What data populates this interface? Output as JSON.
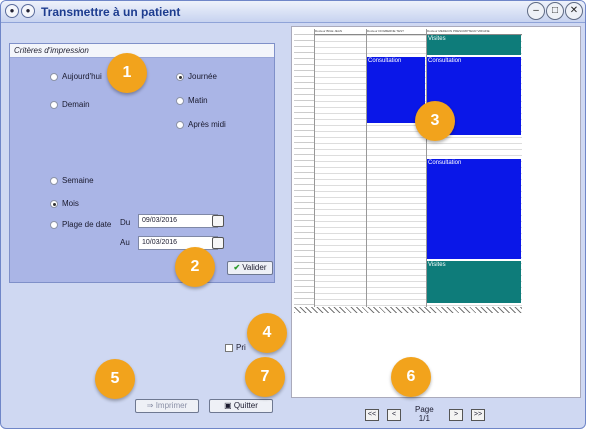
{
  "window": {
    "title": "Transmettre à un patient",
    "controls": [
      "minimize-icon",
      "maximize-icon",
      "close-icon"
    ]
  },
  "criteria": {
    "header": "Critères d'impression",
    "left_options": [
      {
        "label": "Aujourd'hui",
        "selected": false
      },
      {
        "label": "Demain",
        "selected": false
      },
      {
        "label": "Semaine",
        "selected": false
      },
      {
        "label": "Mois",
        "selected": true
      },
      {
        "label": "Plage de date",
        "selected": false
      }
    ],
    "right_options": [
      {
        "label": "Journée",
        "selected": true
      },
      {
        "label": "Matin",
        "selected": false
      },
      {
        "label": "Après midi",
        "selected": false
      }
    ],
    "du_label": "Du",
    "du_value": "09/03/2016",
    "au_label": "Au",
    "au_value": "10/03/2016",
    "valider_label": "Valider"
  },
  "badges": [
    "1",
    "2",
    "3",
    "4",
    "5",
    "6",
    "7"
  ],
  "preview": {
    "columns": [
      "Docteur BIGE JEAN",
      "Docteur DOGBERNE TEST",
      "Docteur MEDECIN PRESCRIPTEUR VIRGINE"
    ],
    "appointments": [
      {
        "label": "Visites",
        "color": "#0e7c7a"
      },
      {
        "label": "Consultation",
        "color": "#0a17e8"
      },
      {
        "label": "Consultation",
        "color": "#0a17e8"
      },
      {
        "label": "Consultation",
        "color": "#0a17e8"
      },
      {
        "label": "Visites",
        "color": "#0e7c7a"
      }
    ]
  },
  "print_checkbox_label": "Pri",
  "buttons": {
    "imprimer": "Imprimer",
    "quitter": "Quitter"
  },
  "pagination": {
    "first": "<<",
    "prev": "<",
    "next": ">",
    "last": ">>",
    "page_label": "Page",
    "page_value": "1/1"
  }
}
